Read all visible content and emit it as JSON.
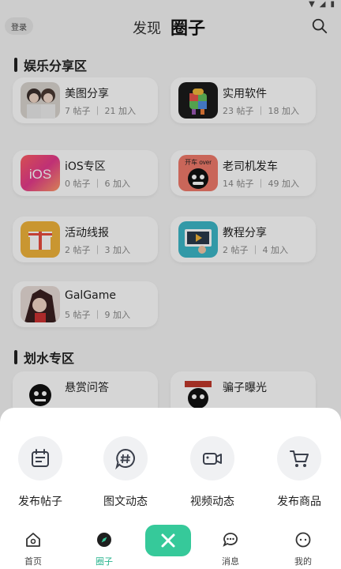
{
  "status": {
    "icons": [
      "wifi-icon",
      "signal-icon",
      "battery-icon"
    ]
  },
  "topnav": {
    "login": "登录",
    "tab_discover": "发现",
    "tab_circle": "圈子"
  },
  "sections": [
    {
      "title": "娱乐分享区",
      "cards": [
        {
          "name": "美图分享",
          "meta": "7 帖子 ｜ 21 加入"
        },
        {
          "name": "实用软件",
          "meta": "23 帖子 ｜ 18 加入"
        },
        {
          "name": "iOS专区",
          "meta": "0 帖子 ｜ 6 加入"
        },
        {
          "name": "老司机发车",
          "meta": "14 帖子 ｜ 49 加入"
        },
        {
          "name": "活动线报",
          "meta": "2 帖子 ｜ 3 加入"
        },
        {
          "name": "教程分享",
          "meta": "2 帖子 ｜ 4 加入"
        },
        {
          "name": "GalGame",
          "meta": "5 帖子 ｜ 9 加入"
        }
      ]
    },
    {
      "title": "划水专区",
      "cards": [
        {
          "name": "悬赏问答",
          "meta": ""
        },
        {
          "name": "骗子曝光",
          "meta": ""
        }
      ]
    }
  ],
  "thumb_text": {
    "ios": "iOS",
    "driver": "开车 over"
  },
  "sheet": {
    "actions": [
      {
        "label": "发布帖子",
        "icon": "calendar-icon"
      },
      {
        "label": "图文动态",
        "icon": "hashtag-icon"
      },
      {
        "label": "视频动态",
        "icon": "video-icon"
      },
      {
        "label": "发布商品",
        "icon": "cart-icon"
      }
    ]
  },
  "bottomnav": {
    "items": [
      {
        "label": "首页",
        "icon": "home-icon"
      },
      {
        "label": "圈子",
        "icon": "compass-icon",
        "active": true
      },
      {
        "label": "消息",
        "icon": "message-icon"
      },
      {
        "label": "我的",
        "icon": "profile-icon"
      }
    ],
    "fab_icon": "close-icon"
  },
  "colors": {
    "accent": "#36c99a",
    "active_label": "#2bb58f",
    "card_bg": "#ffffff",
    "page_bg": "#f5f5f5"
  }
}
